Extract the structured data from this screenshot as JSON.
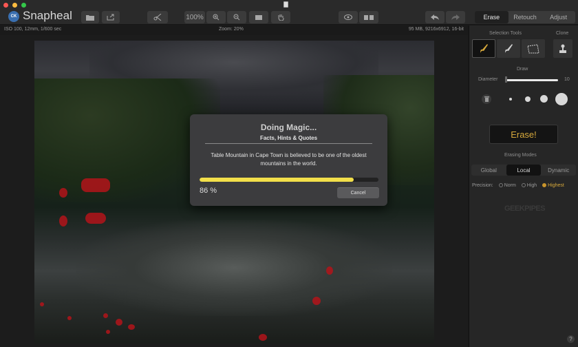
{
  "app": {
    "name": "Snapheal",
    "logo_text": "CK"
  },
  "toolbar": {
    "zoom_level": "100%",
    "tabs": [
      {
        "label": "Erase",
        "active": true
      },
      {
        "label": "Retouch",
        "active": false
      },
      {
        "label": "Adjust",
        "active": false
      }
    ]
  },
  "infobar": {
    "left": "ISO 100, 12mm, 1/600 sec",
    "middle": "Zoom: 20%",
    "right": "95 MB, 9216x6912, 16-bit"
  },
  "panel": {
    "selection_tools_label": "Selection Tools",
    "clone_label": "Clone",
    "draw_label": "Draw",
    "diameter_label": "Diameter",
    "diameter_value": "10",
    "diameter_fraction": 0.02,
    "erase_button": "Erase!",
    "erasing_modes_label": "Erasing Modes",
    "modes": [
      {
        "label": "Global",
        "active": false
      },
      {
        "label": "Local",
        "active": true
      },
      {
        "label": "Dynamic",
        "active": false
      }
    ],
    "precision_label": "Precision:",
    "precision_options": [
      {
        "label": "Norm",
        "selected": false
      },
      {
        "label": "High",
        "selected": false
      },
      {
        "label": "Highest",
        "selected": true
      }
    ],
    "watermark": "GEEKPIPES",
    "help": "?"
  },
  "dialog": {
    "title": "Doing Magic...",
    "subtitle": "Facts, Hints & Quotes",
    "message": "Table Mountain in Cape Town is believed to be one of the oldest mountains in the world.",
    "progress_percent": 86,
    "progress_text": "86 %",
    "cancel_label": "Cancel"
  },
  "colors": {
    "accent_gold": "#d7a93c",
    "progress_yellow": "#f2df4a",
    "selection_red": "#b3141a"
  }
}
